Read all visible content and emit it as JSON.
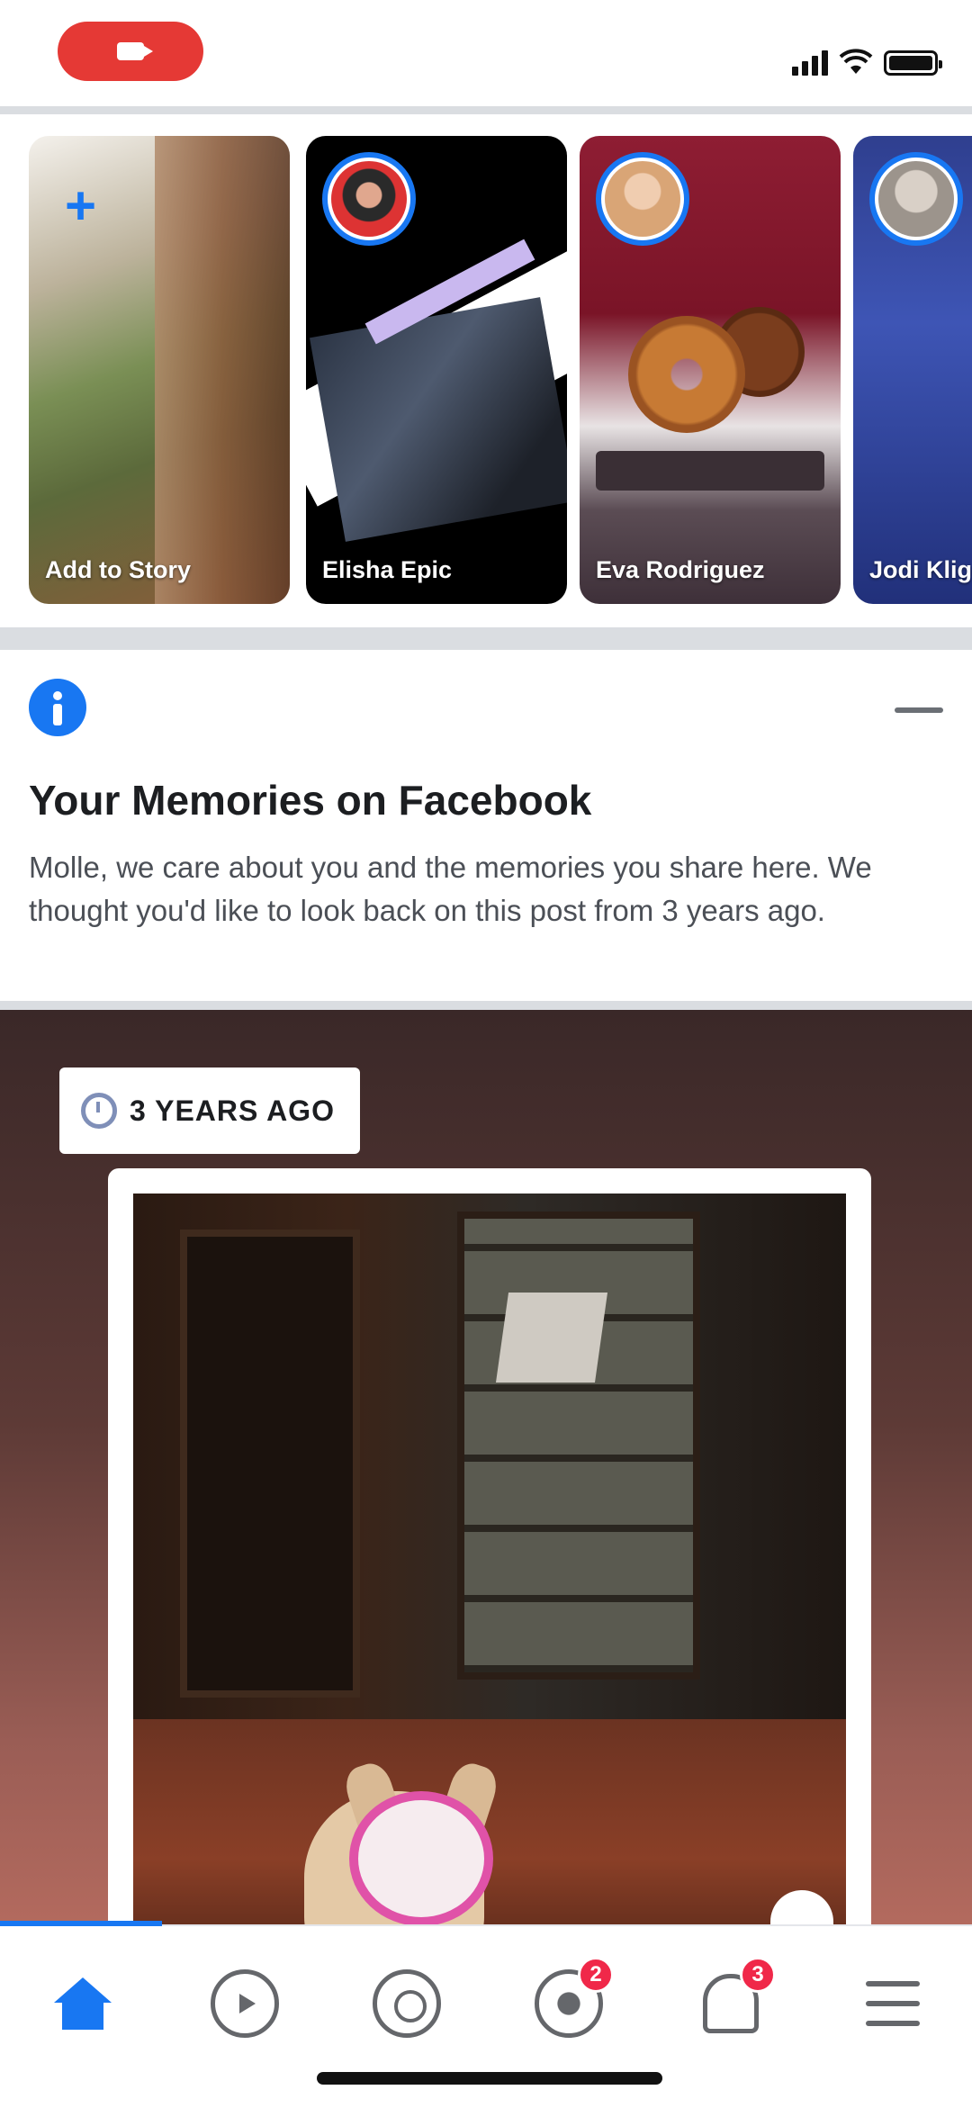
{
  "status_bar": {
    "recording_indicator": "camera-icon",
    "icons": [
      "signal-icon",
      "wifi-icon",
      "battery-icon"
    ]
  },
  "stories": {
    "items": [
      {
        "label": "Add to Story",
        "type": "create",
        "icon": "plus-icon"
      },
      {
        "label": "Elisha Epic",
        "type": "story"
      },
      {
        "label": "Eva Rodriguez",
        "type": "story"
      },
      {
        "label": "Jodi Kligo",
        "type": "story"
      }
    ]
  },
  "memories": {
    "icon": "info-icon",
    "title": "Your Memories on Facebook",
    "body": "Molle, we care about you and the memories you share here. We thought you'd like to look back on this post from 3 years ago."
  },
  "memory_post": {
    "badge_icon": "clock-icon",
    "badge_text": "3 YEARS AGO"
  },
  "tab_bar": {
    "tabs": [
      {
        "name": "home",
        "icon": "home-icon",
        "active": true
      },
      {
        "name": "watch",
        "icon": "watch-icon"
      },
      {
        "name": "groups",
        "icon": "groups-icon"
      },
      {
        "name": "marketplace",
        "icon": "marketplace-icon",
        "badge": "2"
      },
      {
        "name": "notifications",
        "icon": "bell-icon",
        "badge": "3"
      },
      {
        "name": "menu",
        "icon": "menu-icon"
      }
    ]
  },
  "colors": {
    "brand": "#1877f2",
    "badge": "#f02849",
    "recording": "#e53935"
  }
}
